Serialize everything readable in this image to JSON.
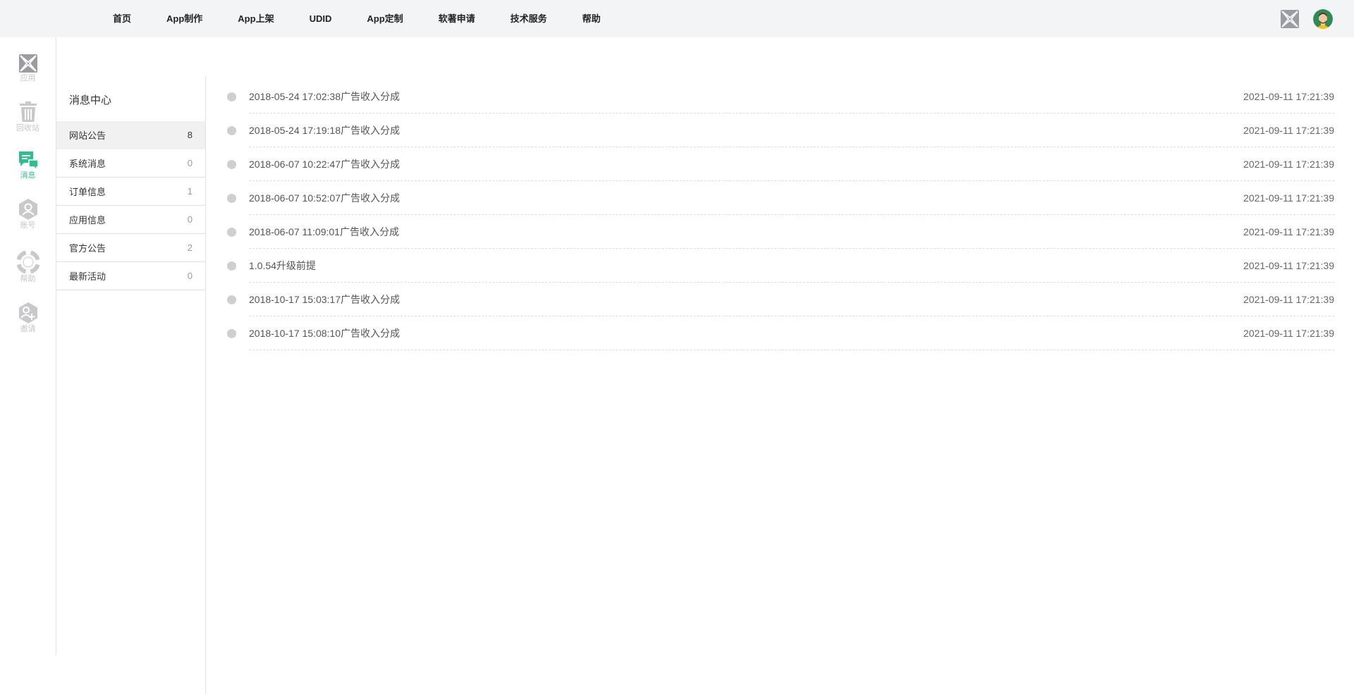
{
  "nav": {
    "items": [
      {
        "label": "首页"
      },
      {
        "label": "App制作"
      },
      {
        "label": "App上架"
      },
      {
        "label": "UDID"
      },
      {
        "label": "App定制"
      },
      {
        "label": "软著申请"
      },
      {
        "label": "技术服务"
      },
      {
        "label": "帮助"
      }
    ]
  },
  "rail": {
    "items": [
      {
        "label": "应用",
        "icon": "grid-icon"
      },
      {
        "label": "回收站",
        "icon": "trash-icon"
      },
      {
        "label": "消息",
        "icon": "message-icon",
        "active": true
      },
      {
        "label": "账号",
        "icon": "account-icon"
      },
      {
        "label": "帮助",
        "icon": "lifebuoy-icon"
      },
      {
        "label": "邀请",
        "icon": "invite-icon"
      }
    ]
  },
  "categories": {
    "title": "消息中心",
    "items": [
      {
        "name": "网站公告",
        "count": "8",
        "active": true
      },
      {
        "name": "系统消息",
        "count": "0"
      },
      {
        "name": "订单信息",
        "count": "1"
      },
      {
        "name": "应用信息",
        "count": "0"
      },
      {
        "name": "官方公告",
        "count": "2"
      },
      {
        "name": "最新活动",
        "count": "0"
      }
    ]
  },
  "messages": [
    {
      "title": "2018-05-24 17:02:38广告收入分成",
      "time": "2021-09-11 17:21:39"
    },
    {
      "title": "2018-05-24 17:19:18广告收入分成",
      "time": "2021-09-11 17:21:39"
    },
    {
      "title": "2018-06-07 10:22:47广告收入分成",
      "time": "2021-09-11 17:21:39"
    },
    {
      "title": "2018-06-07 10:52:07广告收入分成",
      "time": "2021-09-11 17:21:39"
    },
    {
      "title": "2018-06-07 11:09:01广告收入分成",
      "time": "2021-09-11 17:21:39"
    },
    {
      "title": "1.0.54升级前提",
      "time": "2021-09-11 17:21:39"
    },
    {
      "title": "2018-10-17 15:03:17广告收入分成",
      "time": "2021-09-11 17:21:39"
    },
    {
      "title": "2018-10-17 15:08:10广告收入分成",
      "time": "2021-09-11 17:21:39"
    }
  ],
  "colors": {
    "accent": "#2fbf8e",
    "rail_icon": "#c9c9cc",
    "topbar_bg": "#f3f4f6"
  }
}
